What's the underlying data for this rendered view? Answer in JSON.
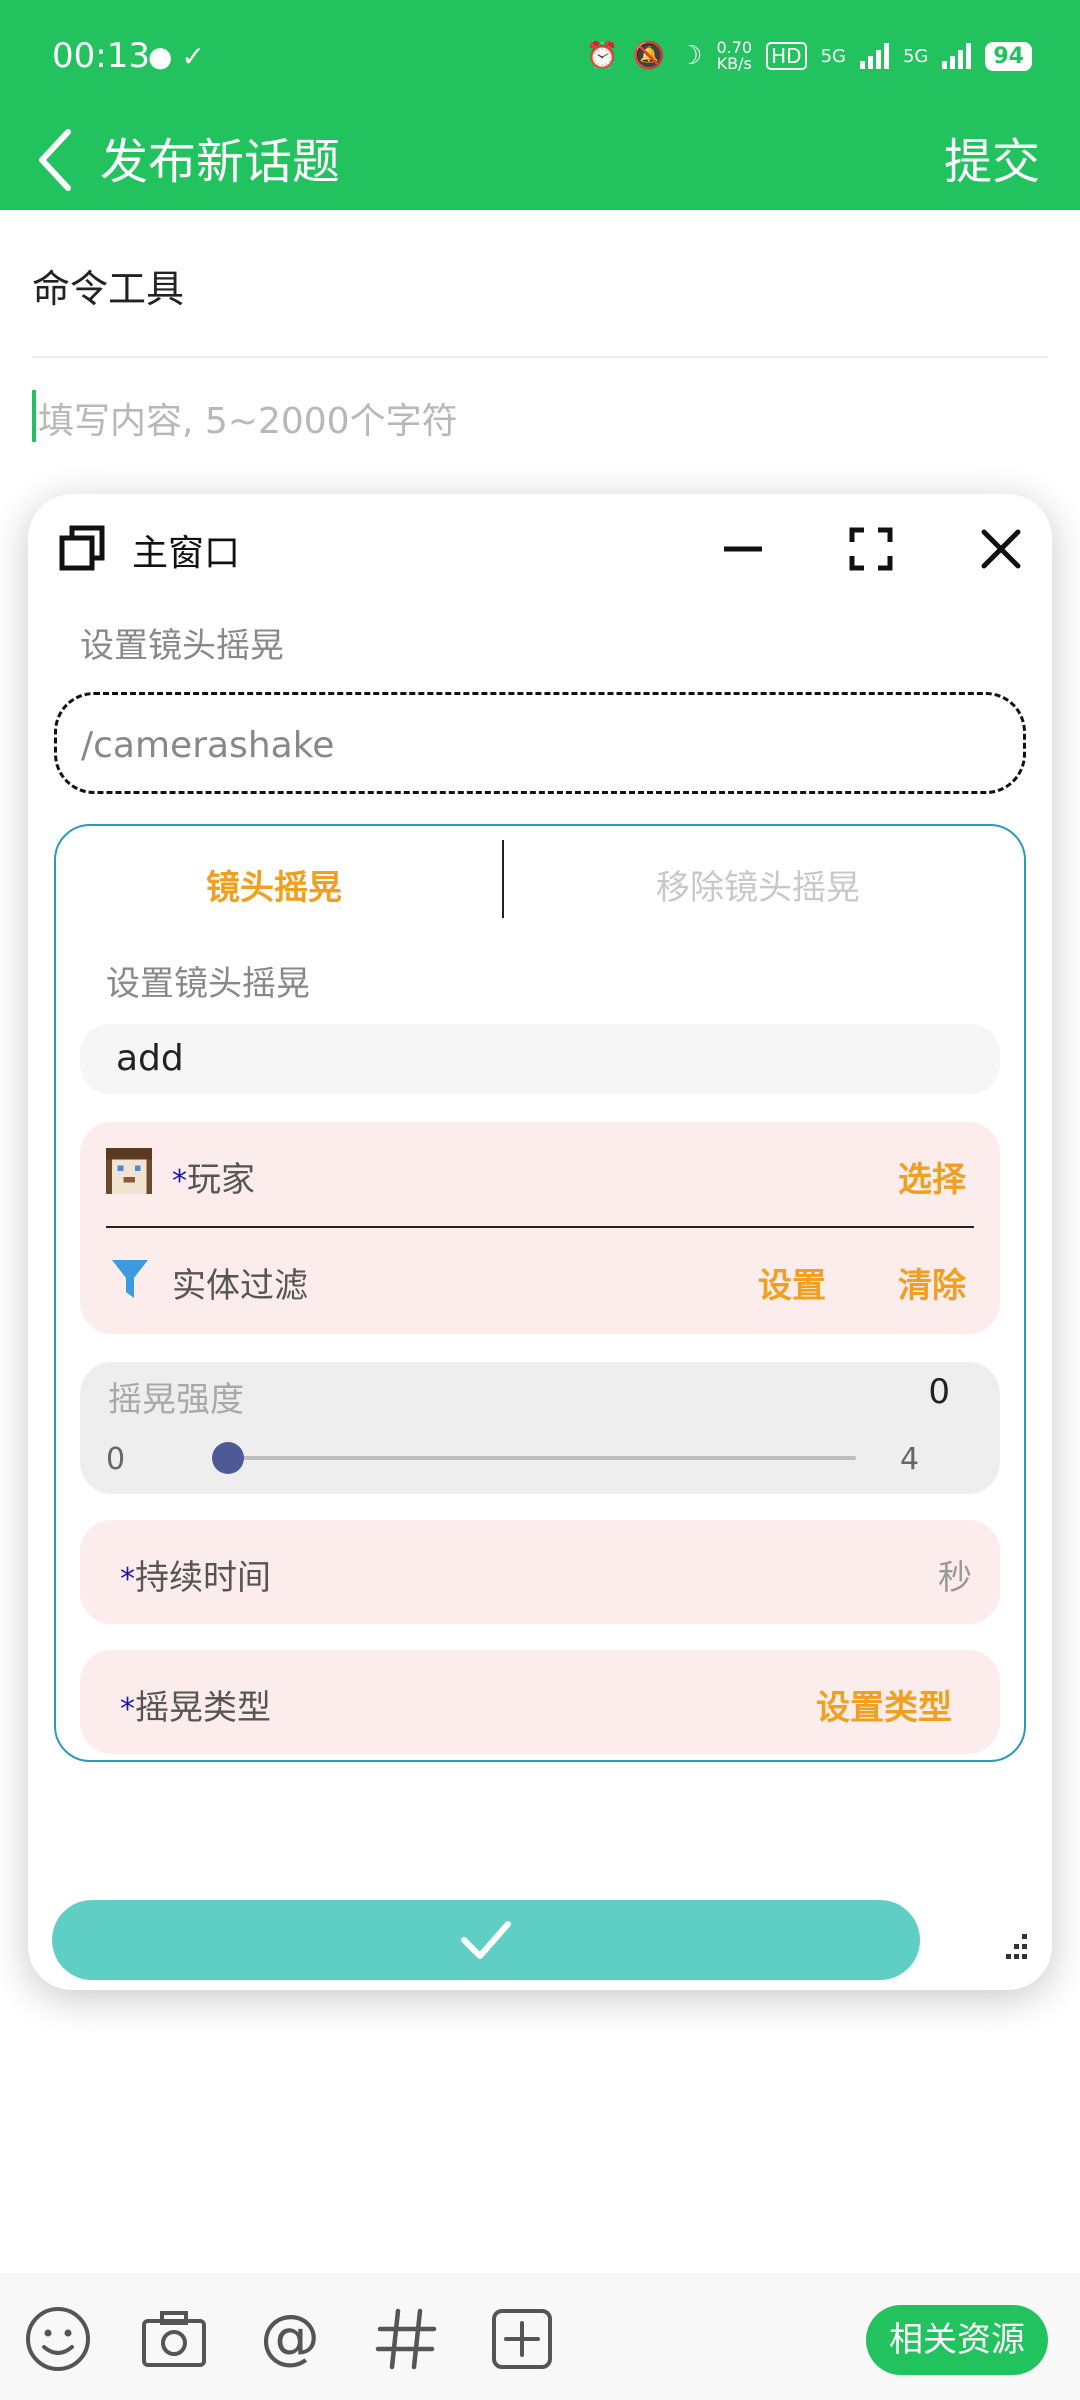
{
  "status_bar": {
    "time": "00:13",
    "net_speed": "0.70",
    "net_unit": "KB/s",
    "hd": "HD",
    "net1": "5G",
    "net2": "5G",
    "battery": "94"
  },
  "header": {
    "title": "发布新话题",
    "submit_label": "提交"
  },
  "editor": {
    "title_value": "命令工具",
    "content_placeholder": "填写内容, 5~2000个字符"
  },
  "window": {
    "title": "主窗口",
    "command_label": "设置镜头摇晃",
    "command_value": "/camerashake",
    "tabs": [
      {
        "label": "镜头摇晃"
      },
      {
        "label": "移除镜头摇晃"
      }
    ],
    "subcommand_label": "设置镜头摇晃",
    "subcommand_value": "add",
    "player": {
      "star": "*",
      "label": "玩家",
      "select_label": "选择"
    },
    "entity_filter": {
      "label": "实体过滤",
      "set_label": "设置",
      "clear_label": "清除"
    },
    "intensity": {
      "label": "摇晃强度",
      "value": "0",
      "min": "0",
      "max": "4",
      "fraction": 0.0
    },
    "duration": {
      "star": "*",
      "label": "持续时间",
      "unit": "秒"
    },
    "shake_type": {
      "star": "*",
      "label": "摇晃类型",
      "action_label": "设置类型"
    }
  },
  "toolbar": {
    "icons": [
      "emoji-icon",
      "camera-icon",
      "at-icon",
      "hashtag-icon",
      "add-box-icon"
    ],
    "resources_label": "相关资源"
  },
  "colors": {
    "brand_green": "#22c35e",
    "accent_orange": "#f0a020",
    "confirm_teal": "#5fcfc6",
    "panel_border": "#2a9bb8"
  }
}
